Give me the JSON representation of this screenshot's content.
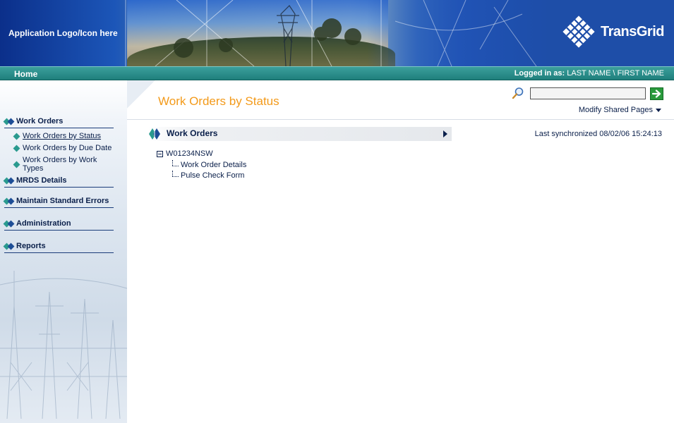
{
  "header": {
    "app_logo_text": "Application Logo/Icon here",
    "brand": "TransGrid"
  },
  "navbar": {
    "home": "Home",
    "logged_in_label": "Logged in as:",
    "user": "LAST NAME \\ FIRST NAME"
  },
  "sidebar": {
    "sections": [
      {
        "label": "Work Orders",
        "items": [
          {
            "label": "Work Orders by Status",
            "active": true
          },
          {
            "label": "Work Orders by Due Date"
          },
          {
            "label": "Work Orders by Work Types"
          }
        ]
      },
      {
        "label": "MRDS Details"
      },
      {
        "label": "Maintain Standard Errors"
      },
      {
        "label": "Administration"
      },
      {
        "label": "Reports"
      }
    ]
  },
  "main": {
    "title": "Work Orders by Status",
    "search": {
      "placeholder": "",
      "value": ""
    },
    "modify_shared": "Modify Shared Pages",
    "webpart": {
      "title": "Work Orders",
      "sync_text": "Last synchronized 08/02/06  15:24:13",
      "tree": {
        "root": "W01234NSW",
        "children": [
          "Work Order Details",
          "Pulse Check Form"
        ]
      }
    }
  },
  "colors": {
    "accent_orange": "#f39a1a",
    "nav_teal": "#1f7f7c",
    "banner_blue": "#1e4ea8",
    "text_navy": "#0a1f4a"
  }
}
